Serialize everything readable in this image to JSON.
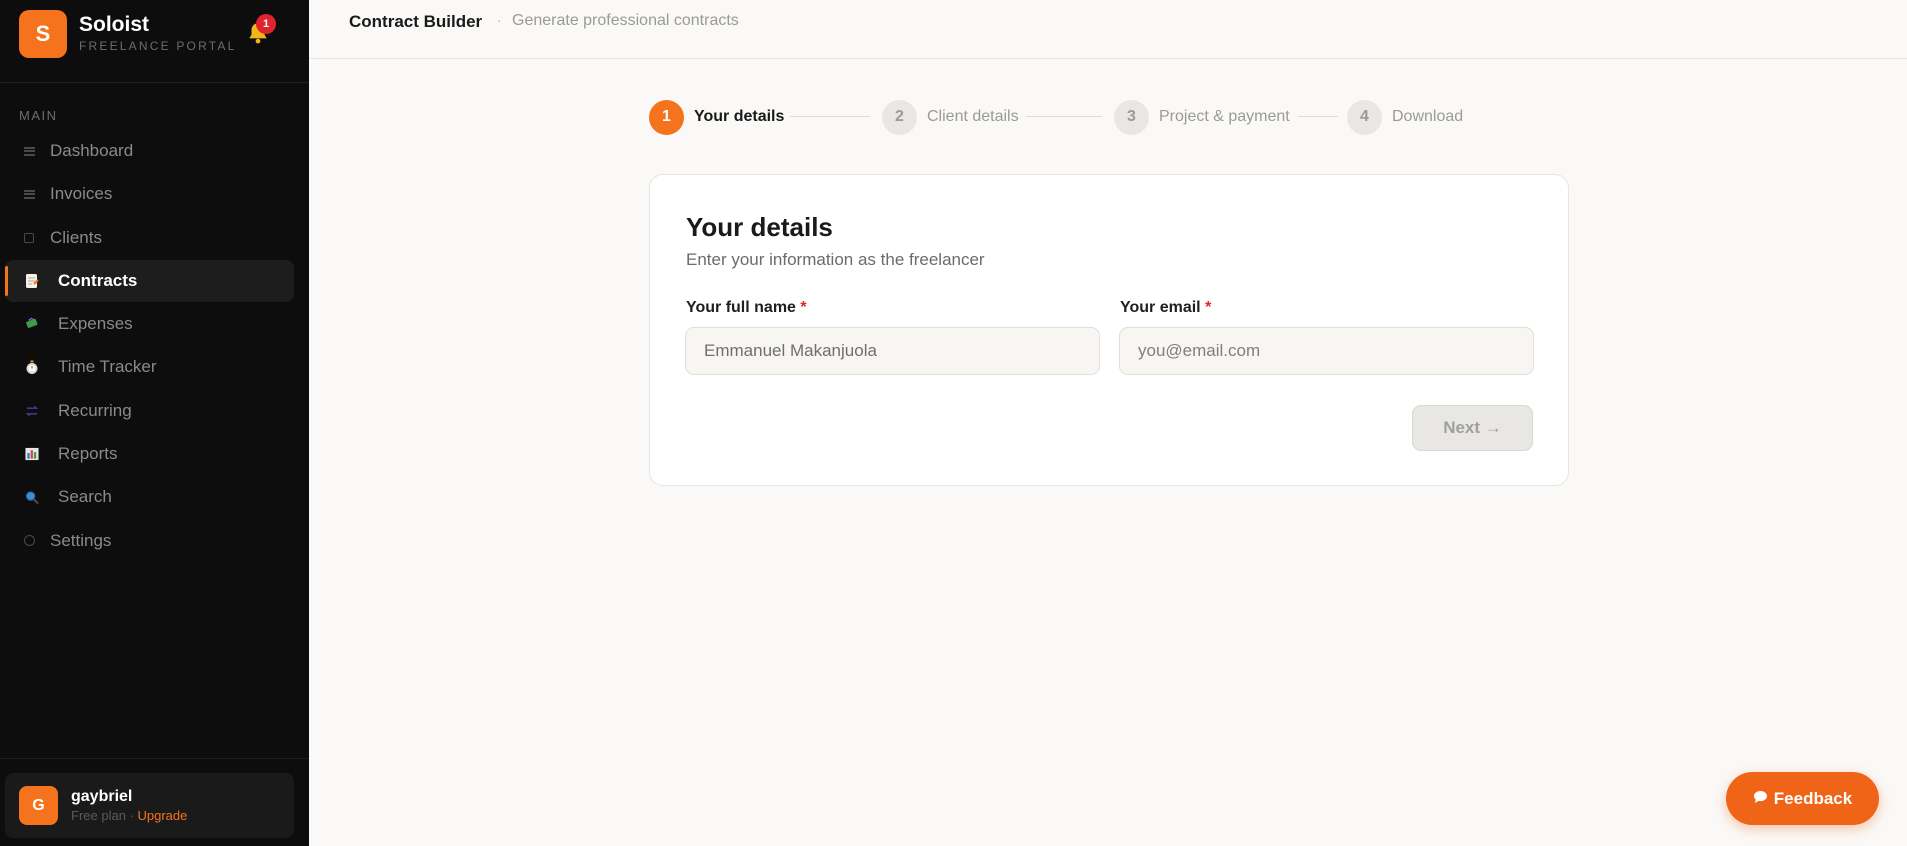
{
  "brand": {
    "logo_letter": "S",
    "name": "Soloist",
    "subtitle": "FREELANCE PORTAL",
    "notification_count": "1"
  },
  "sidebar": {
    "section_label": "MAIN",
    "items": [
      {
        "label": "Dashboard",
        "icon": "grid-icon"
      },
      {
        "label": "Invoices",
        "icon": "invoice-icon"
      },
      {
        "label": "Clients",
        "icon": "clients-icon"
      },
      {
        "label": "Contracts",
        "icon": "contract-icon",
        "active": true
      },
      {
        "label": "Expenses",
        "icon": "money-icon"
      },
      {
        "label": "Time Tracker",
        "icon": "timer-icon"
      },
      {
        "label": "Recurring",
        "icon": "recurring-icon"
      },
      {
        "label": "Reports",
        "icon": "chart-icon"
      },
      {
        "label": "Search",
        "icon": "search-icon"
      },
      {
        "label": "Settings",
        "icon": "gear-icon"
      }
    ],
    "user": {
      "initial": "G",
      "name": "gaybriel",
      "plan": "Free plan · ",
      "upgrade": "Upgrade"
    }
  },
  "topbar": {
    "title": "Contract Builder",
    "separator": "·",
    "subtitle": "Generate professional contracts"
  },
  "stepper": [
    {
      "num": "1",
      "label": "Your details",
      "active": true
    },
    {
      "num": "2",
      "label": "Client details"
    },
    {
      "num": "3",
      "label": "Project & payment"
    },
    {
      "num": "4",
      "label": "Download"
    }
  ],
  "form": {
    "title": "Your details",
    "subtitle": "Enter your information as the freelancer",
    "name_label": "Your full name",
    "name_placeholder": "Emmanuel Makanjuola",
    "email_label": "Your email",
    "email_placeholder": "you@email.com",
    "required_mark": "*",
    "next_label": "Next →"
  },
  "feedback": {
    "label": "Feedback"
  },
  "colors": {
    "accent": "#f5731d",
    "sidebar_bg": "#0d0d0d",
    "badge": "#e0242f"
  }
}
